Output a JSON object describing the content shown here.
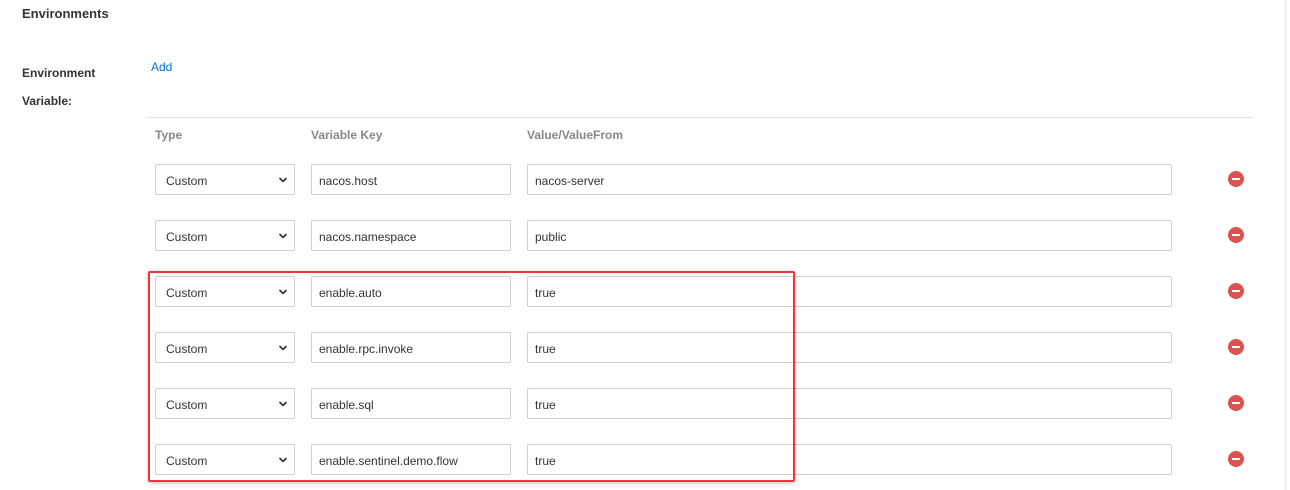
{
  "section": {
    "title": "Environments"
  },
  "form": {
    "label": "Environment Variable:",
    "add_label": "Add"
  },
  "table": {
    "headers": {
      "type": "Type",
      "key": "Variable Key",
      "value": "Value/ValueFrom"
    },
    "rows": [
      {
        "type": "Custom",
        "key": "nacos.host",
        "value": "nacos-server"
      },
      {
        "type": "Custom",
        "key": "nacos.namespace",
        "value": "public"
      },
      {
        "type": "Custom",
        "key": "enable.auto",
        "value": "true"
      },
      {
        "type": "Custom",
        "key": "enable.rpc.invoke",
        "value": "true"
      },
      {
        "type": "Custom",
        "key": "enable.sql",
        "value": "true"
      },
      {
        "type": "Custom",
        "key": "enable.sentinel.demo.flow",
        "value": "true"
      }
    ]
  },
  "icons": {
    "dropdown": "chevron-down-icon",
    "remove": "remove-circle-icon"
  },
  "colors": {
    "link": "#0070cc",
    "remove": "#d9534f",
    "highlight": "#e8383d"
  }
}
